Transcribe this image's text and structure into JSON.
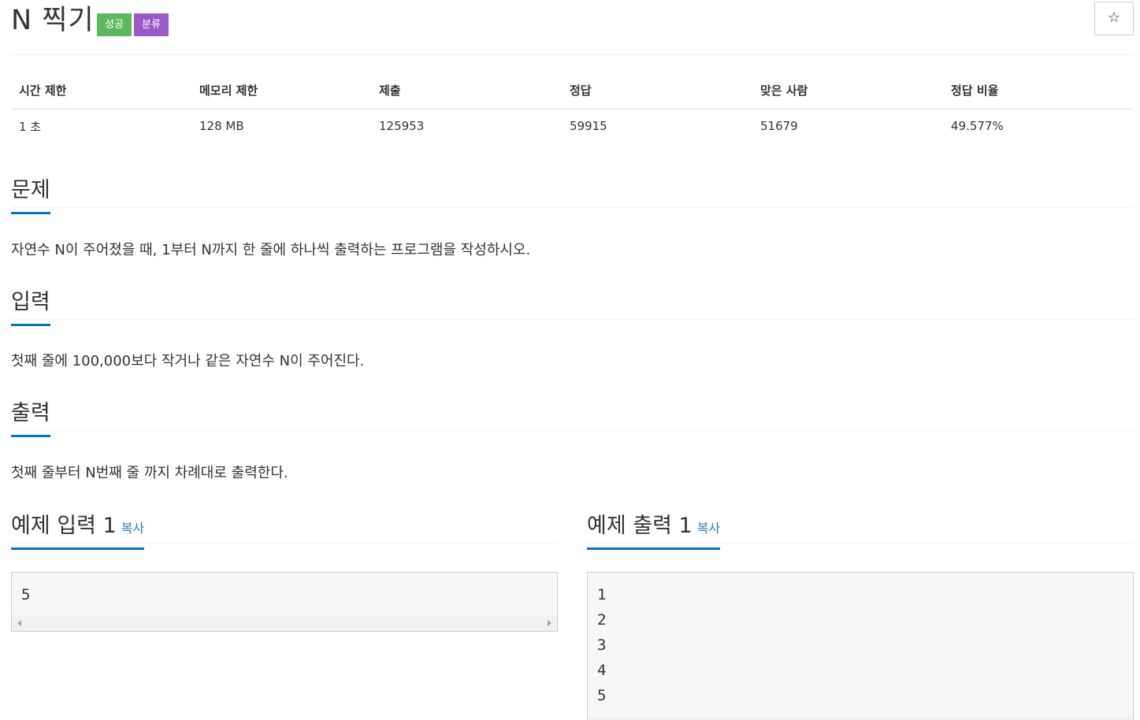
{
  "problem": {
    "title": "N 찍기",
    "badges": {
      "success": "성공",
      "category": "분류"
    },
    "star_icon": "☆"
  },
  "info_table": {
    "headers": [
      "시간 제한",
      "메모리 제한",
      "제출",
      "정답",
      "맞은 사람",
      "정답 비율"
    ],
    "values": [
      "1 초",
      "128 MB",
      "125953",
      "59915",
      "51679",
      "49.577%"
    ]
  },
  "sections": {
    "problem": {
      "heading": "문제",
      "text": "자연수 N이 주어졌을 때, 1부터 N까지 한 줄에 하나씩 출력하는 프로그램을 작성하시오."
    },
    "input": {
      "heading": "입력",
      "text": "첫째 줄에 100,000보다 작거나 같은 자연수 N이 주어진다."
    },
    "output": {
      "heading": "출력",
      "text": "첫째 줄부터 N번째 줄 까지 차례대로 출력한다."
    }
  },
  "samples": {
    "input": {
      "label": "예제 입력 1",
      "copy": "복사",
      "lines": [
        "5"
      ]
    },
    "output": {
      "label": "예제 출력 1",
      "copy": "복사",
      "lines": [
        "1",
        "2",
        "3",
        "4",
        "5"
      ]
    }
  },
  "colors": {
    "success_badge": "#5cb85c",
    "category_badge": "#9b59c6",
    "heading_underline": "#0076c0",
    "copy_link": "#337ab7"
  }
}
